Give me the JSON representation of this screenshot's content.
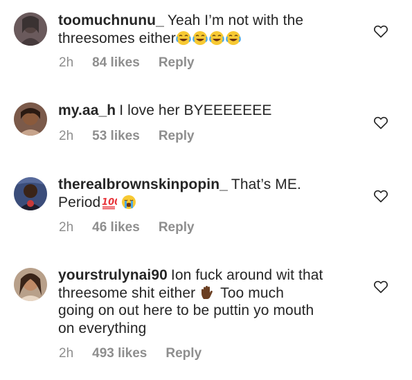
{
  "comments": [
    {
      "username": "toomuchnunu_",
      "lines": [
        "Yeah I’m not with the",
        "threesomes either"
      ],
      "emojis_after": [
        "face-with-tears-of-joy",
        "face-with-tears-of-joy",
        "face-with-tears-of-joy",
        "face-with-tears-of-joy"
      ],
      "time": "2h",
      "likes": "84 likes",
      "reply": "Reply"
    },
    {
      "username": "my.aa_h",
      "lines": [
        "I love her BYEEEEEEE"
      ],
      "time": "2h",
      "likes": "53 likes",
      "reply": "Reply"
    },
    {
      "username": "therealbrownskinpopin_",
      "lines": [
        "That’s ME.",
        "Period"
      ],
      "emojis_after": [
        "hundred-points",
        "loudly-crying-face"
      ],
      "time": "2h",
      "likes": "46 likes",
      "reply": "Reply"
    },
    {
      "username": "yourstrulynai90",
      "lines": [
        "Ion fuck around wit that",
        "threesome shit either",
        "Too much",
        "going on out here to be puttin yo mouth",
        "on everything"
      ],
      "emojis_after": [
        "raised-hand-dark-skin-tone"
      ],
      "time": "2h",
      "likes": "493 likes",
      "reply": "Reply"
    }
  ],
  "icons": {
    "like": "heart-outline-icon"
  },
  "colors": {
    "text": "#262626",
    "meta": "#8e8e8e"
  }
}
